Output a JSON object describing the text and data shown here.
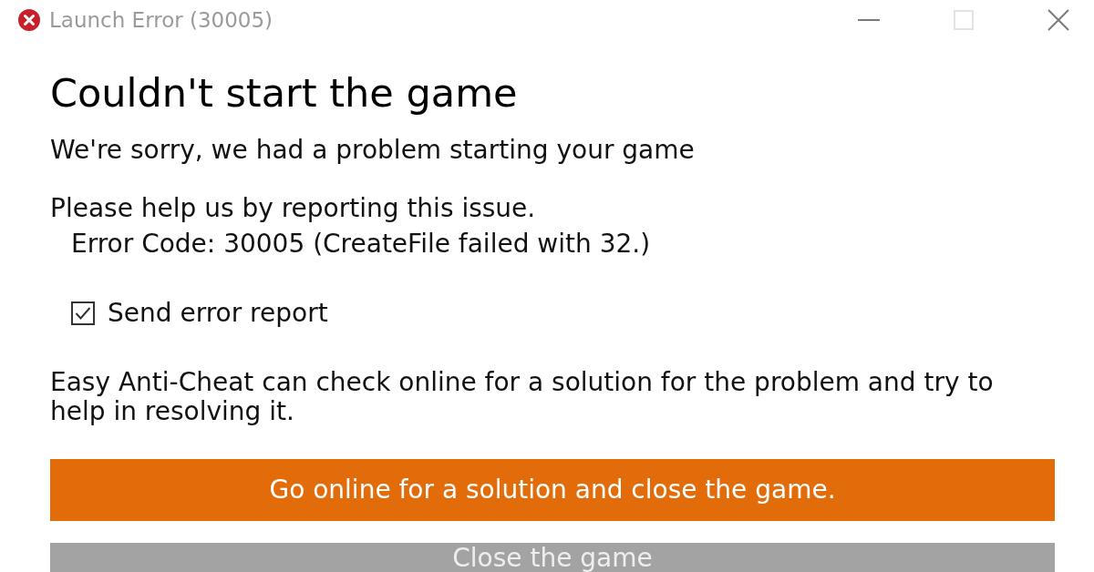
{
  "window": {
    "title": "Launch Error (30005)",
    "controls": [
      {
        "kind": "minimize",
        "disabled": false
      },
      {
        "kind": "maximize",
        "disabled": true
      },
      {
        "kind": "close",
        "disabled": false
      }
    ]
  },
  "heading": "Couldn't start the game",
  "subtitle": "We're sorry, we had a problem starting your game",
  "report_prompt": "Please help us by reporting this issue.",
  "error_code": "Error Code: 30005 (CreateFile failed with 32.)",
  "send_report": {
    "label": "Send error report",
    "checked": true
  },
  "description": "Easy Anti-Cheat can check online for a solution for the problem and try to help in resolving it.",
  "buttons": [
    {
      "label": "Go online for a solution and close the game.",
      "kind": "primary"
    },
    {
      "label": "Close the game",
      "kind": "secondary"
    }
  ]
}
